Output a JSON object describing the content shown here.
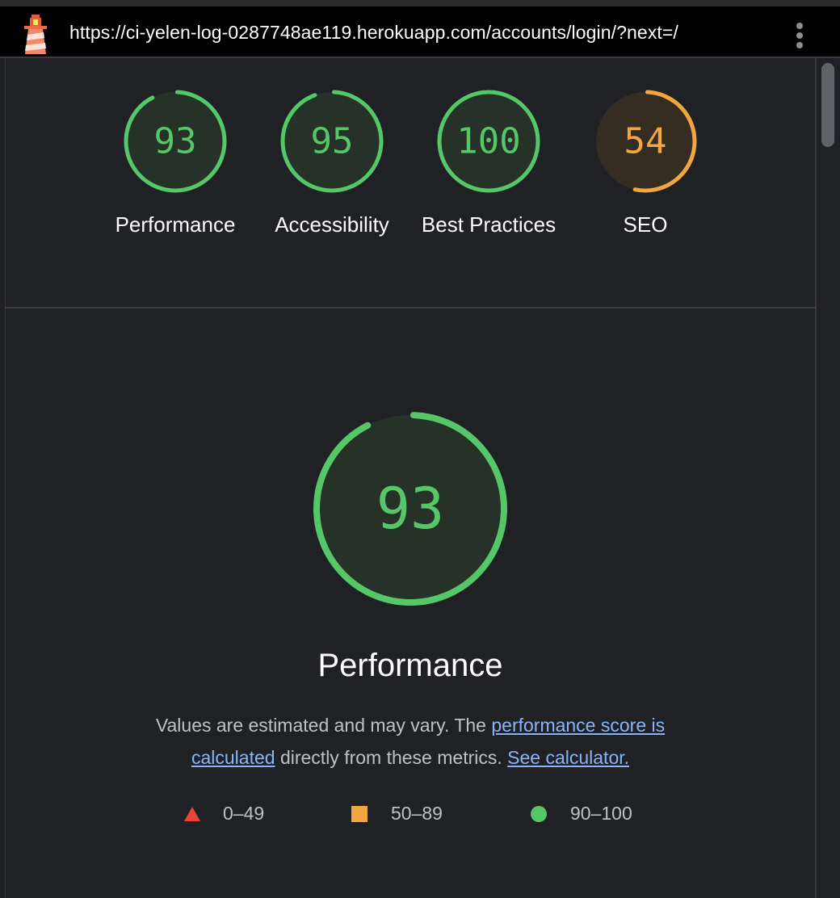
{
  "header": {
    "url": "https://ci-yelen-log-0287748ae119.herokuapp.com/accounts/login/?next=/",
    "logo_icon": "lighthouse-icon",
    "menu_icon": "kebab-menu-icon"
  },
  "summary": {
    "gauges": [
      {
        "score": "93",
        "fraction": 0.93,
        "label": "Performance",
        "status": "pass"
      },
      {
        "score": "95",
        "fraction": 0.95,
        "label": "Accessibility",
        "status": "pass"
      },
      {
        "score": "100",
        "fraction": 1.0,
        "label": "Best Practices",
        "status": "pass"
      },
      {
        "score": "54",
        "fraction": 0.54,
        "label": "SEO",
        "status": "average"
      }
    ]
  },
  "performance": {
    "score": "93",
    "fraction": 0.93,
    "title": "Performance",
    "desc_prefix": "Values are estimated and may vary. The ",
    "desc_link1": "performance score is calculated",
    "desc_middle": " directly from these metrics. ",
    "desc_link2": "See calculator."
  },
  "legend": [
    {
      "icon": "triangle-fail-icon",
      "range": "0–49"
    },
    {
      "icon": "square-average-icon",
      "range": "50–89"
    },
    {
      "icon": "circle-pass-icon",
      "range": "90–100"
    }
  ],
  "colors": {
    "pass": "#55c768",
    "pass_bg": "#263228",
    "average": "#f2a640",
    "average_bg": "#352c22",
    "fail": "#eb4335",
    "link": "#8ab4f8",
    "background": "#202124"
  }
}
